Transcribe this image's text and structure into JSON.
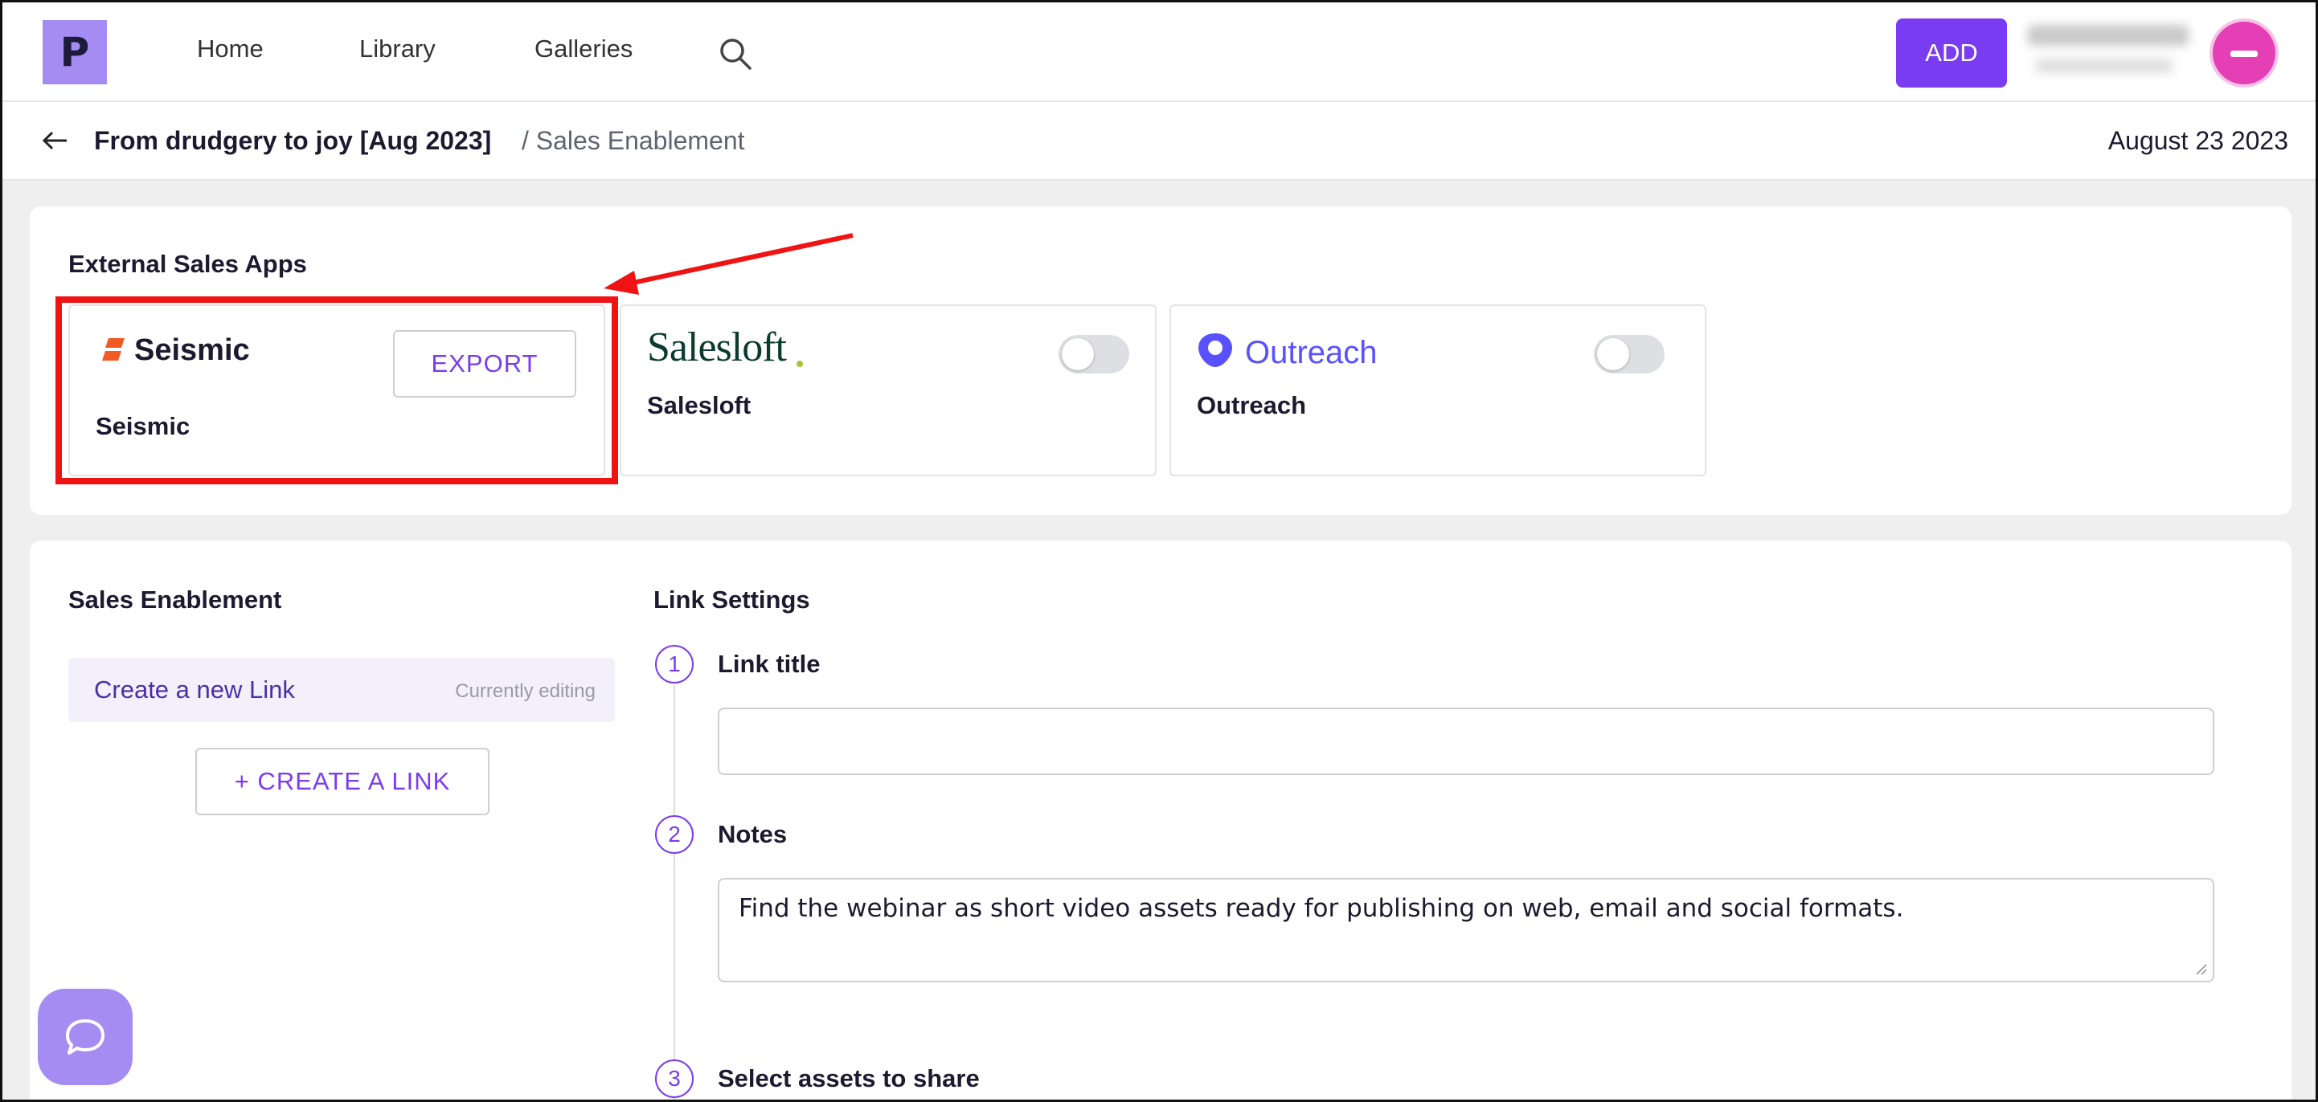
{
  "nav": {
    "logo_letter": "P",
    "items": [
      "Home",
      "Library",
      "Galleries"
    ],
    "add_label": "ADD"
  },
  "breadcrumb": {
    "main": "From drudgery to joy [Aug 2023]",
    "sub": "/ Sales Enablement",
    "date": "August 23 2023"
  },
  "apps": {
    "title": "External Sales Apps",
    "cards": [
      {
        "logo_text": "Seismic",
        "name": "Seismic",
        "action": "EXPORT"
      },
      {
        "logo_text": "Salesloft",
        "name": "Salesloft"
      },
      {
        "logo_text": "Outreach",
        "name": "Outreach"
      }
    ],
    "colors": {
      "seismic": "#f15a24",
      "salesloft": "#0c3b2e",
      "outreach": "#5951ff"
    }
  },
  "enablement": {
    "title": "Sales Enablement",
    "link_item": {
      "label": "Create a new Link",
      "status": "Currently editing"
    },
    "create_label": "+ CREATE A LINK"
  },
  "settings": {
    "title": "Link Settings",
    "steps": [
      {
        "num": "1",
        "label": "Link title",
        "value": ""
      },
      {
        "num": "2",
        "label": "Notes",
        "value": "Find the webinar as short video assets ready for publishing on web, email and social formats."
      },
      {
        "num": "3",
        "label": "Select assets to share"
      }
    ]
  },
  "icons": {
    "search": "search-icon",
    "back": "arrow-left-icon",
    "chat": "chat-bubble-icon"
  },
  "theme": {
    "accent": "#7a3cf0",
    "highlight": "#f01313"
  }
}
